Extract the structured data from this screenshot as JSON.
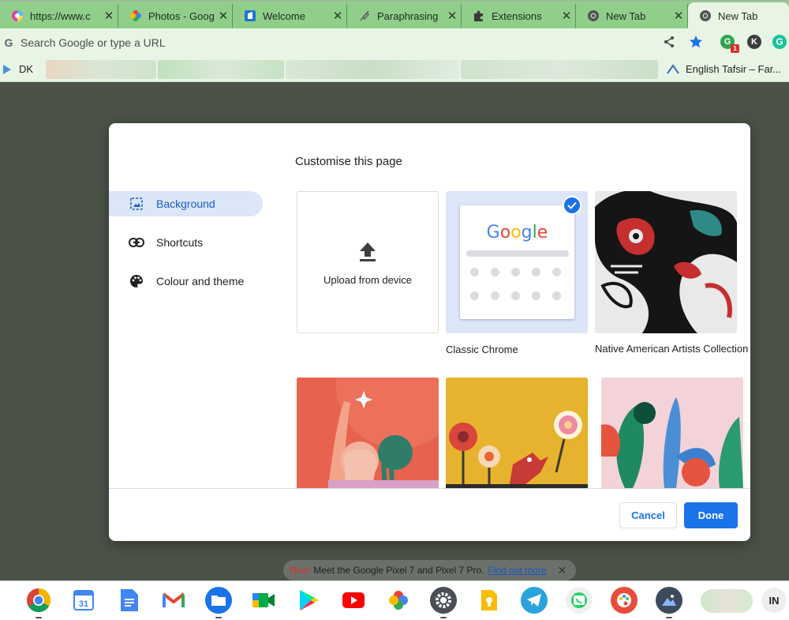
{
  "tabs": [
    {
      "title": "https://www.c",
      "icon": "color-wheel-icon"
    },
    {
      "title": "Photos - Goog",
      "icon": "google-photos-icon"
    },
    {
      "title": "Welcome",
      "icon": "ms-todo-icon"
    },
    {
      "title": "Paraphrasing",
      "icon": "quill-icon"
    },
    {
      "title": "Extensions",
      "icon": "puzzle-icon"
    },
    {
      "title": "New Tab",
      "icon": "chrome-icon"
    },
    {
      "title": "New Tab",
      "icon": "chrome-icon",
      "active": true
    }
  ],
  "omnibox": {
    "placeholder": "Search Google or type a URL"
  },
  "extensions": {
    "ext1": "G",
    "ext1_badge": "1",
    "ext2": "K",
    "ext3": "G"
  },
  "bookmarks": {
    "first": "DK",
    "last": "English Tafsir – Far..."
  },
  "dialog": {
    "title": "Customise this page",
    "sidebar": [
      {
        "label": "Background",
        "icon": "background-icon",
        "active": true
      },
      {
        "label": "Shortcuts",
        "icon": "link-icon"
      },
      {
        "label": "Colour and theme",
        "icon": "palette-icon"
      }
    ],
    "tiles": {
      "upload": "Upload from device",
      "classic": "Classic Chrome",
      "classic_logo": "Google",
      "native": "Native American Artists Collection"
    },
    "buttons": {
      "cancel": "Cancel",
      "done": "Done"
    }
  },
  "promo": {
    "new": "New!",
    "text": "Meet the Google Pixel 7 and Pixel 7 Pro.",
    "link": "Find out more"
  },
  "shelf": {
    "apps": [
      "chrome-icon",
      "calendar-icon",
      "docs-icon",
      "gmail-icon",
      "files-icon",
      "meet-icon",
      "play-store-icon",
      "youtube-icon",
      "photos-icon",
      "settings-icon",
      "keep-icon",
      "telegram-icon",
      "whatsapp-icon",
      "palette-app-icon",
      "screen-capture-icon"
    ],
    "calendar_day": "31",
    "ime": "IN"
  },
  "colors": {
    "accent": "#1a73e8",
    "tabstrip": "#8fcf8a",
    "toolbar": "#e8f5e5",
    "backdrop": "#4a5247"
  }
}
